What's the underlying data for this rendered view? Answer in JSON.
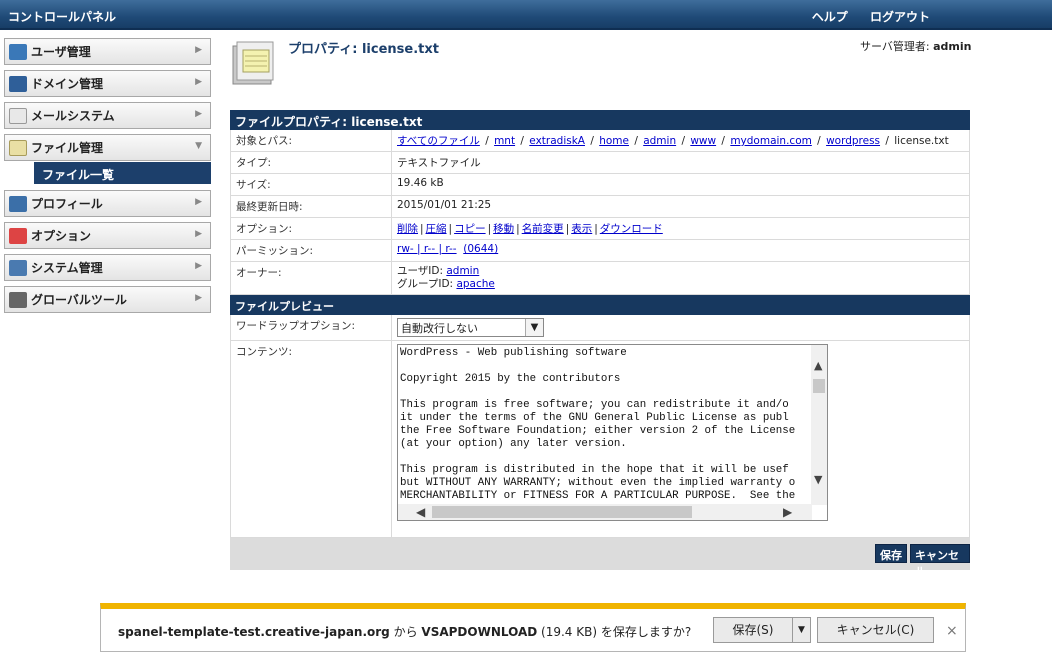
{
  "topbar": {
    "title": "コントロールパネル",
    "help": "ヘルプ",
    "logout": "ログアウト"
  },
  "sidebar": {
    "items": [
      {
        "label": "ユーザ管理",
        "icon": "user-icon"
      },
      {
        "label": "ドメイン管理",
        "icon": "domain-icon"
      },
      {
        "label": "メールシステム",
        "icon": "mail-icon"
      },
      {
        "label": "ファイル管理",
        "icon": "file-icon"
      },
      {
        "label": "プロフィール",
        "icon": "profile-icon"
      },
      {
        "label": "オプション",
        "icon": "options-icon"
      },
      {
        "label": "システム管理",
        "icon": "system-icon"
      },
      {
        "label": "グローバルツール",
        "icon": "tools-icon"
      }
    ],
    "subitem": "ファイル一覧"
  },
  "header": {
    "title": "プロパティ: license.txt",
    "admin_prefix": "サーバ管理者: ",
    "admin_name": "admin"
  },
  "props": {
    "section_title": "ファイルプロパティ: license.txt",
    "path_label": "対象とパス:",
    "path": [
      "すべてのファイル",
      "mnt",
      "extradiskA",
      "home",
      "admin",
      "www",
      "mydomain.com",
      "wordpress"
    ],
    "path_file": "license.txt",
    "type_label": "タイプ:",
    "type_value": "テキストファイル",
    "size_label": "サイズ:",
    "size_value": "19.46  kB",
    "modified_label": "最終更新日時:",
    "modified_value": "2015/01/01 21:25",
    "options_label": "オプション:",
    "options": [
      "削除",
      "圧縮",
      "コピー",
      "移動",
      "名前変更",
      "表示",
      "ダウンロード"
    ],
    "perm_label": "パーミッション:",
    "perm_value": "rw- | r-- | r--",
    "perm_octal": "(0644)",
    "owner_label": "オーナー:",
    "owner_user_label": "ユーザID:",
    "owner_user": "admin",
    "owner_group_label": "グループID:",
    "owner_group": "apache"
  },
  "preview": {
    "section_title": "ファイルプレビュー",
    "wrap_label": "ワードラップオプション:",
    "wrap_value": "自動改行しない",
    "content_label": "コンテンツ:",
    "content": "WordPress - Web publishing software\n\nCopyright 2015 by the contributors\n\nThis program is free software; you can redistribute it and/o\nit under the terms of the GNU General Public License as publ\nthe Free Software Foundation; either version 2 of the License\n(at your option) any later version.\n\nThis program is distributed in the hope that it will be usef\nbut WITHOUT ANY WARRANTY; without even the implied warranty o\nMERCHANTABILITY or FITNESS FOR A PARTICULAR PURPOSE.  See the"
  },
  "actions": {
    "save": "保存",
    "cancel": "キャンセル"
  },
  "download": {
    "host": "spanel-template-test.creative-japan.org",
    "from": " から ",
    "file": "VSAPDOWNLOAD",
    "size": " (19.4 KB) を保存しますか?",
    "save": "保存(S)",
    "cancel": "キャンセル(C)",
    "close": "×"
  }
}
